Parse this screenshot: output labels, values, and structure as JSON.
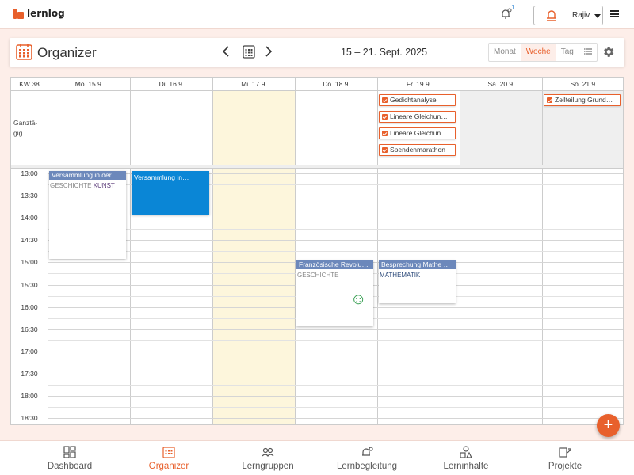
{
  "app": {
    "logo_text": "lernlog",
    "notification_count": "1",
    "user_name": "Rajiv"
  },
  "organizer": {
    "title": "Organizer",
    "date_range": "15 – 21. Sept. 2025",
    "views": [
      "Monat",
      "Woche",
      "Tag"
    ],
    "active_view": "Woche"
  },
  "calendar": {
    "week_label": "KW 38",
    "days": [
      "Mo. 15.9.",
      "Di. 16.9.",
      "Mi. 17.9.",
      "Do. 18.9.",
      "Fr. 19.9.",
      "Sa. 20.9.",
      "So. 21.9."
    ],
    "allday_label": "Ganztä- gig",
    "times": [
      "13:00",
      "13:30",
      "14:00",
      "14:30",
      "15:00",
      "15:30",
      "16:00",
      "16:30",
      "17:00",
      "17:30",
      "18:00",
      "18:30"
    ],
    "allday_tasks": [
      {
        "day": 4,
        "label": "Gedichtanalyse"
      },
      {
        "day": 4,
        "label": "Lineare Gleichun…"
      },
      {
        "day": 4,
        "label": "Lineare Gleichun…"
      },
      {
        "day": 4,
        "label": "Spendenmarathon"
      },
      {
        "day": 6,
        "label": "Zellteilung Grund…"
      }
    ],
    "events": [
      {
        "title": "Versammlung in der",
        "subjects": [
          "GESCHICHTE",
          "KUNST"
        ]
      },
      {
        "title": "Versammlung in…"
      },
      {
        "title": "Französische Revolu…",
        "subjects": [
          "GESCHICHTE"
        ],
        "emoji": "☺"
      },
      {
        "title": "Besprechung Mathe …",
        "subjects": [
          "MATHEMATIK"
        ]
      }
    ]
  },
  "bottom_nav": [
    "Dashboard",
    "Organizer",
    "Lerngruppen",
    "Lernbegleitung",
    "Lerninhalte",
    "Projekte"
  ],
  "colors": {
    "accent": "#e8602c",
    "event_header": "#6c88bb",
    "event_selected": "#0a86d6",
    "today_bg": "#fdf6dc",
    "weekend_bg": "#efefef"
  }
}
